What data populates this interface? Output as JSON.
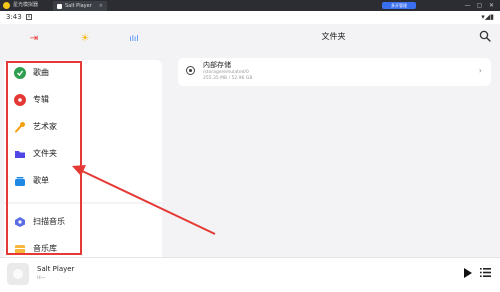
{
  "window": {
    "app_name": "星光模拟器",
    "tab_title": "Salt Player",
    "tab_close": "×",
    "badge": "多开管理",
    "controls": [
      "—",
      "▢",
      "✕"
    ]
  },
  "statusbar": {
    "time": "3:43",
    "notif": "A",
    "right": "▾◢▮"
  },
  "left": {
    "top_icons": [
      {
        "name": "exit-icon",
        "glyph": "⇥",
        "color": "#e53935"
      },
      {
        "name": "sun-icon",
        "glyph": "☀",
        "color": "#f4b400"
      },
      {
        "name": "equalizer-icon",
        "glyph": "ılıl",
        "color": "#3b82f6"
      }
    ],
    "items": [
      {
        "label": "歌曲",
        "icon": "song-icon",
        "color": "#2e9e4f"
      },
      {
        "label": "专辑",
        "icon": "album-icon",
        "color": "#e53935"
      },
      {
        "label": "艺术家",
        "icon": "artist-icon",
        "color": "#f59e0b"
      },
      {
        "label": "文件夹",
        "icon": "folder-icon",
        "color": "#4f46e5"
      },
      {
        "label": "歌单",
        "icon": "playlist-icon",
        "color": "#1e88e5"
      },
      {
        "label": "扫描音乐",
        "icon": "scan-icon",
        "color": "#5b6ee1"
      },
      {
        "label": "音乐库",
        "icon": "library-icon",
        "color": "#f6b73c"
      }
    ]
  },
  "main": {
    "title": "文件夹",
    "storage": {
      "name": "内部存储",
      "path": "/storage/emulated/0",
      "size": "255.35 MB / 52.96 GB"
    }
  },
  "player": {
    "title": "Salt Player",
    "artist": "Hi~"
  }
}
